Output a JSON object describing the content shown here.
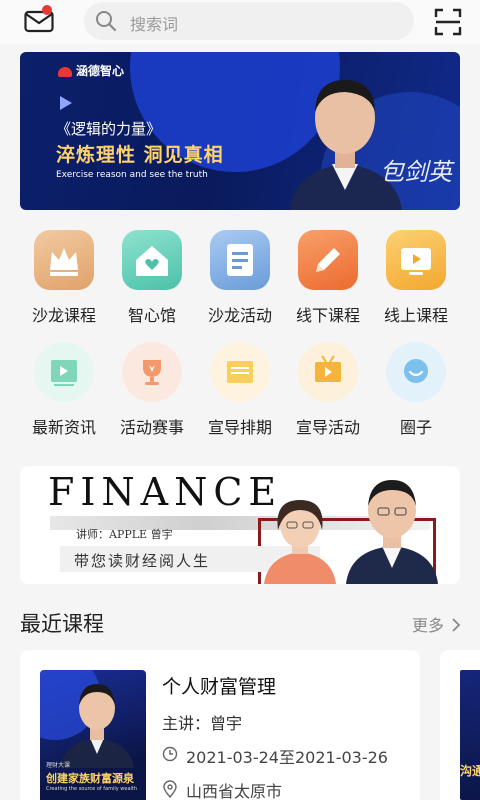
{
  "topbar": {
    "search_placeholder": "搜索词",
    "icons": [
      "mail-icon",
      "search-icon",
      "scan-icon"
    ],
    "notification_dot_color": "#e53935"
  },
  "banner": {
    "logo": "涵德智心",
    "title": "《逻辑的力量》",
    "slogan": "淬炼理性 洞见真相",
    "subtitle": "Exercise reason and see the truth",
    "signature": "包剑英"
  },
  "grid": {
    "row1": [
      {
        "label": "沙龙课程",
        "icon": "crown-icon",
        "color": "#e8b27a"
      },
      {
        "label": "智心馆",
        "icon": "home-heart-icon",
        "color": "#5ccfb7"
      },
      {
        "label": "沙龙活动",
        "icon": "document-icon",
        "color": "#76a9e0"
      },
      {
        "label": "线下课程",
        "icon": "pencil-icon",
        "color": "#f27a3a"
      },
      {
        "label": "线上课程",
        "icon": "tv-icon",
        "color": "#f4b23e"
      }
    ],
    "row2": [
      {
        "label": "最新资讯",
        "icon": "news-icon",
        "color": "#5cc9a4"
      },
      {
        "label": "活动赛事",
        "icon": "trophy-icon",
        "color": "#f08a5a"
      },
      {
        "label": "宣导排期",
        "icon": "calendar-icon",
        "color": "#f6c24c"
      },
      {
        "label": "宣导活动",
        "icon": "tv-play-icon",
        "color": "#f5b73c"
      },
      {
        "label": "圈子",
        "icon": "chat-bubble-icon",
        "color": "#6ab7e8"
      }
    ]
  },
  "finance_banner": {
    "title": "FINANCE",
    "lecturer": "讲师：APPLE  曾宇",
    "tagline": "带您读财经阅人生"
  },
  "section": {
    "title": "最近课程",
    "more": "更多"
  },
  "courses": [
    {
      "thumb_small": "理财大课",
      "thumb_title": "创建家族财富源泉",
      "thumb_sub": "Creating the source of family wealth",
      "name": "个人财富管理",
      "teacher": "主讲：曾宇",
      "dates": "2021-03-24至2021-03-26",
      "location": "山西省太原市"
    }
  ],
  "card2": {
    "thumb_text": "沟通"
  }
}
